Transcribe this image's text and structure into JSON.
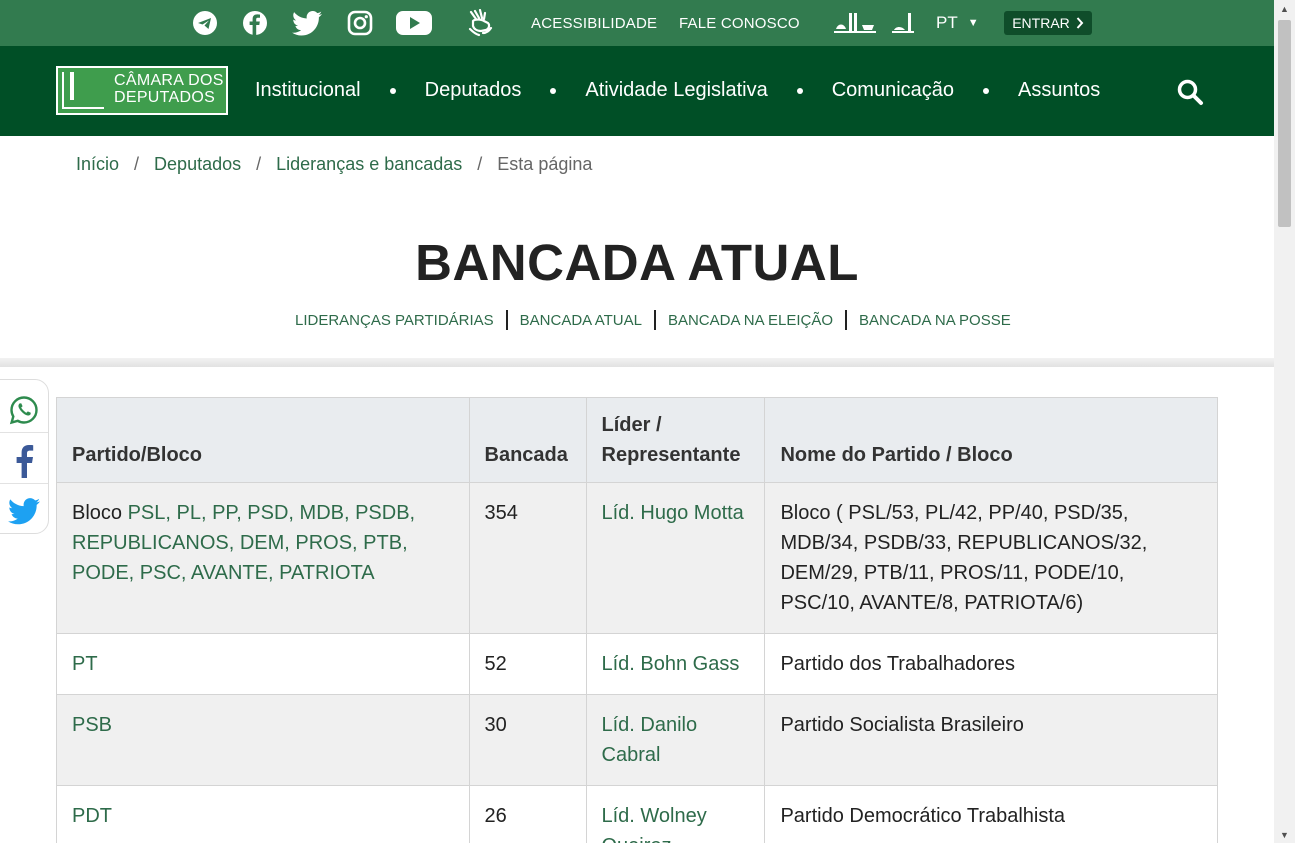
{
  "topbar": {
    "social_icons": [
      "telegram-icon",
      "facebook-icon",
      "twitter-icon",
      "instagram-icon",
      "youtube-icon",
      "libras-icon"
    ],
    "accessibility": "ACESSIBILIDADE",
    "contact": "FALE CONOSCO",
    "lang": "PT",
    "login": "ENTRAR"
  },
  "nav": {
    "logo_line1": "CÂMARA DOS",
    "logo_line2": "DEPUTADOS",
    "items": [
      "Institucional",
      "Deputados",
      "Atividade Legislativa",
      "Comunicação",
      "Assuntos"
    ]
  },
  "breadcrumb": {
    "items": [
      "Início",
      "Deputados",
      "Lideranças e bancadas"
    ],
    "current": "Esta página"
  },
  "page": {
    "title": "BANCADA ATUAL",
    "subnav": [
      "LIDERANÇAS PARTIDÁRIAS",
      "BANCADA ATUAL",
      "BANCADA NA ELEIÇÃO",
      "BANCADA NA POSSE"
    ]
  },
  "share": [
    "whatsapp-icon",
    "facebook-icon",
    "twitter-icon"
  ],
  "table": {
    "headers": [
      "Partido/Bloco",
      "Bancada",
      "Líder / Representante",
      "Nome do Partido / Bloco"
    ],
    "rows": [
      {
        "party_prefix": "Bloco ",
        "party": "PSL, PL, PP, PSD, MDB, PSDB, REPUBLICANOS, DEM, PROS, PTB, PODE, PSC, AVANTE, PATRIOTA",
        "seats": "354",
        "leader": "Líd. Hugo Motta",
        "name": "Bloco ( PSL/53, PL/42, PP/40, PSD/35, MDB/34, PSDB/33, REPUBLICANOS/32, DEM/29, PTB/11, PROS/11, PODE/10, PSC/10, AVANTE/8, PATRIOTA/6)"
      },
      {
        "party_prefix": "",
        "party": "PT",
        "seats": "52",
        "leader": "Líd. Bohn Gass",
        "name": "Partido dos Trabalhadores"
      },
      {
        "party_prefix": "",
        "party": "PSB",
        "seats": "30",
        "leader": "Líd. Danilo Cabral",
        "name": "Partido Socialista Brasileiro"
      },
      {
        "party_prefix": "",
        "party": "PDT",
        "seats": "26",
        "leader": "Líd. Wolney Queiroz",
        "name": "Partido Democrático Trabalhista"
      }
    ]
  }
}
